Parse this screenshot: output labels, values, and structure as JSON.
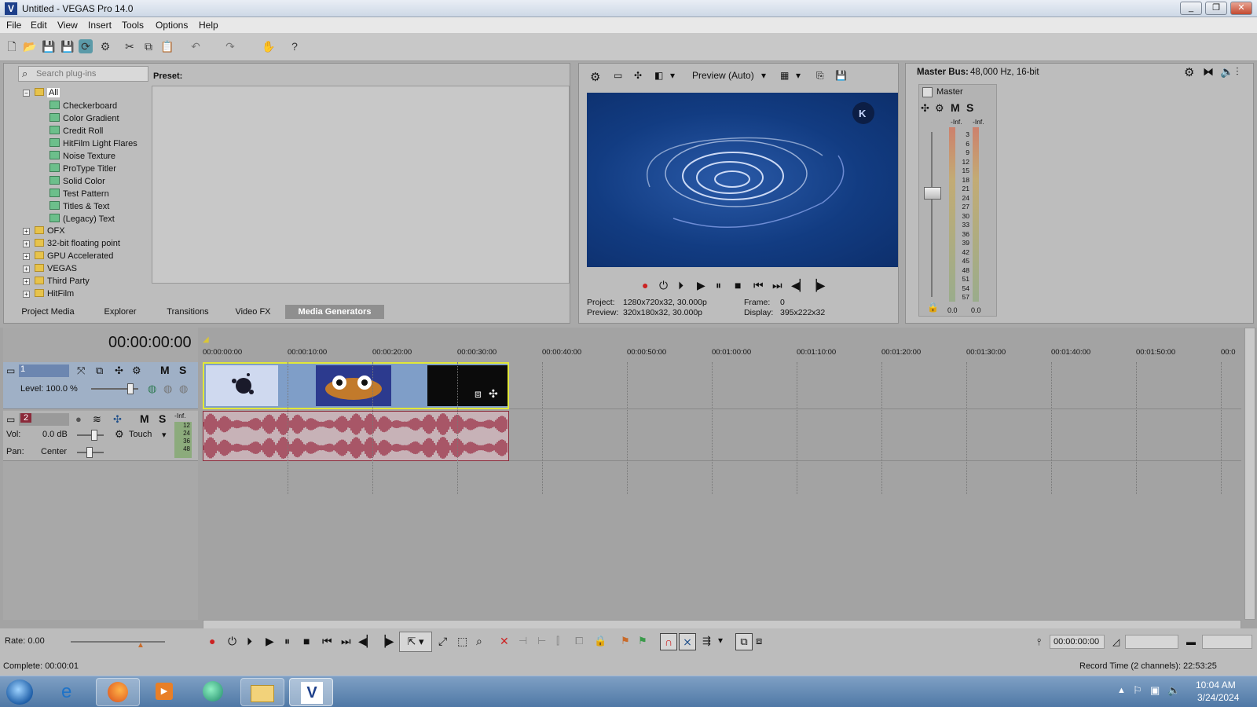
{
  "window": {
    "title": "Untitled - VEGAS Pro 14.0",
    "controls": [
      "_",
      "❐",
      "✕"
    ]
  },
  "menu": [
    "File",
    "Edit",
    "View",
    "Insert",
    "Tools",
    "Options",
    "Help"
  ],
  "plugins": {
    "search_placeholder": "Search plug-ins",
    "root": "All",
    "items": [
      "Checkerboard",
      "Color Gradient",
      "Credit Roll",
      "HitFilm Light Flares",
      "Noise Texture",
      "ProType Titler",
      "Solid Color",
      "Test Pattern",
      "Titles & Text",
      "(Legacy) Text"
    ],
    "folders": [
      "OFX",
      "32-bit floating point",
      "GPU Accelerated",
      "VEGAS",
      "Third Party",
      "HitFilm"
    ],
    "preset_label": "Preset:"
  },
  "tabs": [
    "Project Media",
    "Explorer",
    "Transitions",
    "Video FX",
    "Media Generators"
  ],
  "active_tab": "Media Generators",
  "preview": {
    "mode": "Preview (Auto)",
    "project_label": "Project:",
    "project_value": "1280x720x32, 30.000p",
    "preview_label": "Preview:",
    "preview_value": "320x180x32, 30.000p",
    "frame_label": "Frame:",
    "frame_value": "0",
    "display_label": "Display:",
    "display_value": "395x222x32"
  },
  "mixer": {
    "label": "Master Bus:",
    "info": "48,000 Hz, 16-bit",
    "master": "Master",
    "m": "M",
    "s": "S",
    "inf_left": "-Inf.",
    "inf_right": "-Inf.",
    "scale": [
      "3",
      "6",
      "9",
      "12",
      "15",
      "18",
      "21",
      "24",
      "27",
      "30",
      "33",
      "36",
      "39",
      "42",
      "45",
      "48",
      "51",
      "54",
      "57"
    ],
    "peak_left": "0.0",
    "peak_right": "0.0"
  },
  "timeline": {
    "timecode": "00:00:00:00",
    "ruler": [
      "00:00:00:00",
      "00:00:10:00",
      "00:00:20:00",
      "00:00:30:00",
      "00:00:40:00",
      "00:00:50:00",
      "00:01:00:00",
      "00:01:10:00",
      "00:01:20:00",
      "00:01:30:00",
      "00:01:40:00",
      "00:01:50:00",
      "00:0"
    ],
    "video_track": {
      "number": "1",
      "level_label": "Level: 100.0 %",
      "m": "M",
      "s": "S"
    },
    "audio_track": {
      "number": "2",
      "vol_label": "Vol:",
      "vol_value": "0.0 dB",
      "pan_label": "Pan:",
      "pan_value": "Center",
      "touch": "Touch",
      "inf": "-Inf.",
      "meter_scale": [
        "12",
        "24",
        "36",
        "48"
      ],
      "m": "M",
      "s": "S"
    }
  },
  "transport": {
    "rate": "Rate: 0.00",
    "timecode": "00:00:00:00"
  },
  "status": {
    "complete": "Complete: 00:00:01",
    "record_time": "Record Time (2 channels): 22:53:25"
  },
  "taskbar": {
    "time": "10:04 AM",
    "date": "3/24/2024"
  },
  "colors": {
    "accent_blue": "#123c82",
    "clip_selected": "#e2e838",
    "waveform": "#9b2f45"
  }
}
